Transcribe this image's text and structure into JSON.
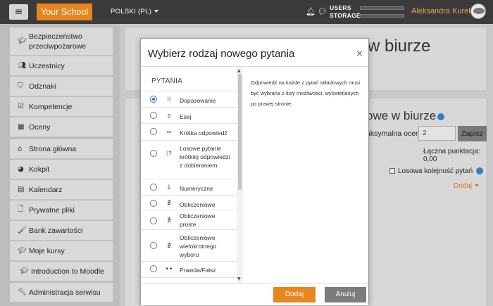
{
  "navbar": {
    "menu_icon": "≡",
    "brand": "Your School",
    "language": "POLSKI (PL)",
    "users_label": "USERS",
    "storage_label": "STORAGE",
    "username": "Aleksandra Kurek"
  },
  "sidebar": {
    "items": [
      {
        "label": "Bezpieczeństwo przeciwpożarowe",
        "icon": "graduation-cap-icon"
      },
      {
        "label": "Uczestnicy",
        "icon": "users-icon"
      },
      {
        "label": "Odznaki",
        "icon": "shield-icon"
      },
      {
        "label": "Kompetencje",
        "icon": "checkbox-icon"
      },
      {
        "label": "Oceny",
        "icon": "table-icon"
      },
      {
        "label": "Strona główna",
        "icon": "home-icon"
      },
      {
        "label": "Kokpit",
        "icon": "dashboard-icon"
      },
      {
        "label": "Kalendarz",
        "icon": "calendar-icon"
      },
      {
        "label": "Prywatne pliki",
        "icon": "file-icon"
      },
      {
        "label": "Bank zawartości",
        "icon": "brush-icon"
      },
      {
        "label": "Moje kursy",
        "icon": "graduation-cap-icon"
      },
      {
        "label": "Introduction to Moodle",
        "icon": "graduation-cap-icon"
      },
      {
        "label": "Administracja serwisu",
        "icon": "wrench-icon"
      }
    ]
  },
  "background": {
    "title": "w biurze",
    "subtitle": "owe w biurze",
    "max_grade_label": "aksymalna ocena",
    "max_grade_value": "2",
    "save_button": "Zapisz",
    "total_points": "Łączna punktacja: 0,00",
    "shuffle_label": "Losowa kolejność pytań",
    "add_menu": "Dodaj"
  },
  "modal": {
    "title": "Wybierz rodzaj nowego pytania",
    "close": "×",
    "list_header": "PYTANIA",
    "question_types": [
      {
        "label": "Dopasowanie",
        "icon": "⁞⁞",
        "checked": true
      },
      {
        "label": "Esej",
        "icon": "▯",
        "checked": false
      },
      {
        "label": "Krótka odpowiedź",
        "icon": "▭",
        "checked": false
      },
      {
        "label": "Losowe pytanie krótkiej odpowiedzi z dobieraniem",
        "icon": "⁞?",
        "checked": false
      },
      {
        "label": "Numeryczne",
        "icon": "⊥",
        "checked": false
      },
      {
        "label": "Obliczeniowe",
        "icon": "∄",
        "checked": false
      },
      {
        "label": "Obliczeniowe proste",
        "icon": "∄",
        "checked": false
      },
      {
        "label": "Obliczeniowe wielokrotnego wyboru",
        "icon": "∄",
        "checked": false
      },
      {
        "label": "Prawda/Fałsz",
        "icon": "••",
        "checked": false
      }
    ],
    "description": "Odpowiedź na każde z pytań składowych musi być wybrana z listy możliwości, wyświetlanych po prawej stronie.",
    "add_button": "Dodaj",
    "cancel_button": "Anuluj"
  }
}
